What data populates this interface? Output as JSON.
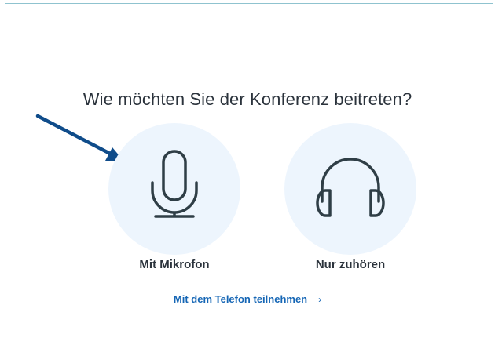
{
  "prompt": {
    "title": "Wie möchten Sie der Konferenz beitreten?"
  },
  "options": [
    {
      "label": "Mit Mikrofon",
      "icon": "microphone-icon"
    },
    {
      "label": "Nur zuhören",
      "icon": "headphones-icon"
    }
  ],
  "phone_link": {
    "label": "Mit dem Telefon teilnehmen",
    "chevron": "›"
  },
  "colors": {
    "circle_bg": "#edf5fd",
    "icon_stroke": "#2f3e46",
    "link": "#1566b5",
    "arrow": "#0f4c8a",
    "frame_border": "#8fc3cf"
  }
}
